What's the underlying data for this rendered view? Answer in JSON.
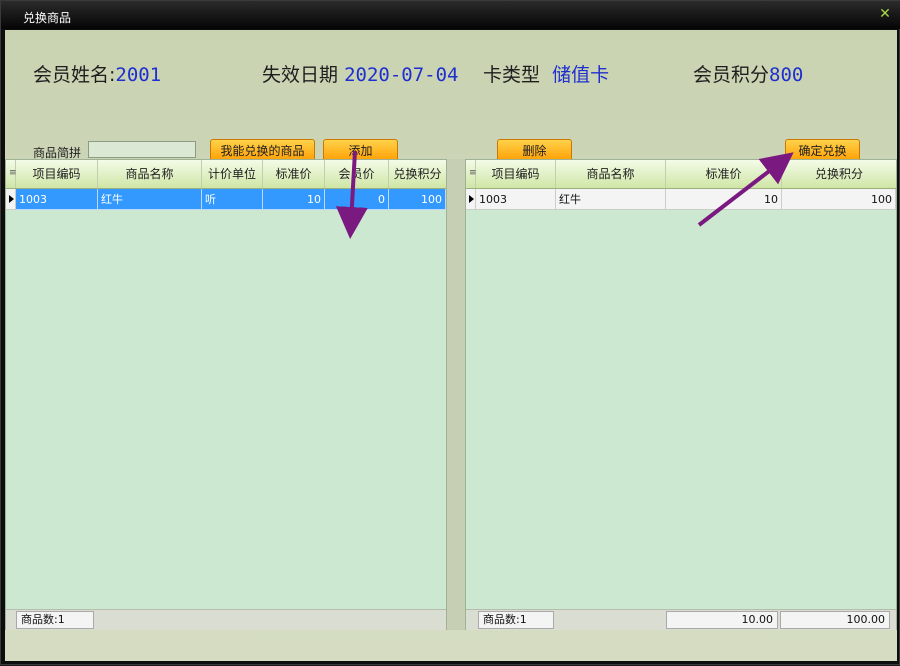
{
  "window": {
    "title": "兑换商品",
    "close_glyph": "✕",
    "close_icon": "close-icon"
  },
  "member": {
    "name_label": "会员姓名:",
    "name_value": "2001",
    "expiry_label": "失效日期",
    "expiry_value": "2020-07-04",
    "card_type_label": "卡类型",
    "card_type_value": "储值卡",
    "points_label": "会员积分",
    "points_value": "800"
  },
  "search": {
    "label": "商品简拼",
    "value": ""
  },
  "buttons": {
    "my_items": "我能兑换的商品",
    "add": "添加",
    "delete": "删除",
    "confirm": "确定兑换"
  },
  "left_grid": {
    "columns": [
      "项目编码",
      "商品名称",
      "计价单位",
      "标准价",
      "会员价",
      "兑换积分"
    ],
    "rows": [
      {
        "code": "1003",
        "name": "红牛",
        "unit": "听",
        "std_price": "10",
        "member_price": "0",
        "points": "100"
      }
    ],
    "footer_count": "商品数:1"
  },
  "right_grid": {
    "columns": [
      "项目编码",
      "商品名称",
      "标准价",
      "兑换积分"
    ],
    "rows": [
      {
        "code": "1003",
        "name": "红牛",
        "std_price": "10",
        "points": "100"
      }
    ],
    "footer_count": "商品数:1",
    "footer_price_total": "10.00",
    "footer_points_total": "100.00"
  },
  "colors": {
    "accent_value": "#1f2fcf",
    "button_orange": "#ff9c00",
    "selected_row": "#3399ff",
    "grid_bg": "#cde8d0",
    "annotation_arrow": "#7a1a80"
  },
  "icons": {
    "row_indicator": "row-pointer-icon",
    "header_corner": "grid-corner-icon"
  }
}
